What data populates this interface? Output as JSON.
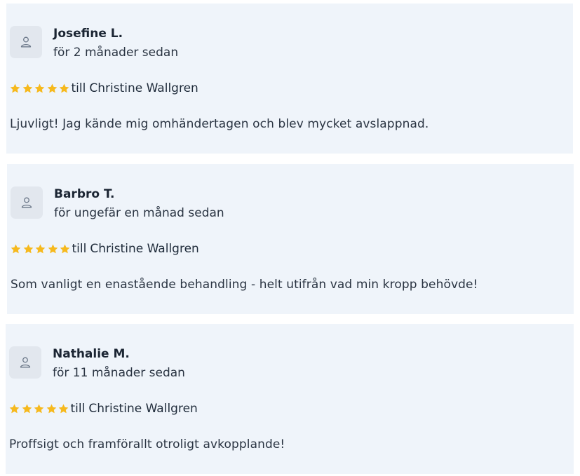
{
  "colors": {
    "card_background": "#eff4fa",
    "avatar_background": "#e2e7ee",
    "star": "#f6b91d",
    "text": "#1f2b3a"
  },
  "reviews": [
    {
      "name": "Josefine L.",
      "time": "för 2 månader sedan",
      "rating": 5,
      "staff_prefix": "till",
      "staff_name": "Christine Wallgren",
      "text": "Ljuvligt! Jag kände mig omhändertagen och blev mycket avslappnad.",
      "avatar_icon": "user-icon"
    },
    {
      "name": "Barbro T.",
      "time": "för ungefär en månad sedan",
      "rating": 5,
      "staff_prefix": "till",
      "staff_name": "Christine Wallgren",
      "text": "Som vanligt en enastående behandling - helt utifrån vad min kropp behövde!",
      "avatar_icon": "user-icon"
    },
    {
      "name": "Nathalie M.",
      "time": "för 11 månader sedan",
      "rating": 5,
      "staff_prefix": "till",
      "staff_name": "Christine Wallgren",
      "text": "Proffsigt och framförallt otroligt avkopplande!",
      "avatar_icon": "user-icon"
    }
  ]
}
